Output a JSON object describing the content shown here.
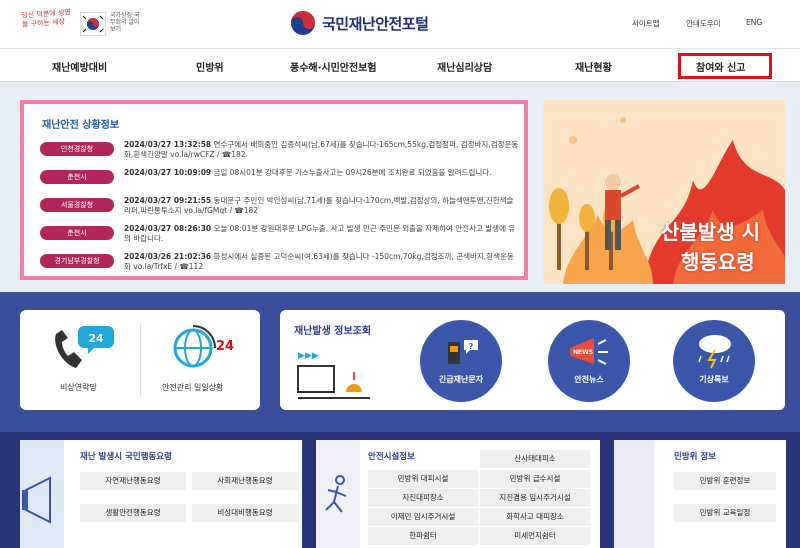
{
  "header": {
    "slogan": "당신 덕분에 생명을 구하는 세상",
    "gov_text": "국가상징 국무회의 알아보기",
    "logo_text": "국민재난안전포털",
    "util": [
      "사이트맵",
      "안내도우미",
      "ENG"
    ]
  },
  "nav": [
    "재난예방대비",
    "민방위",
    "풍수해·시민안전보험",
    "재난심리상담",
    "재난현황",
    "참여와 신고"
  ],
  "status": {
    "title": "재난안전 상황정보",
    "alerts": [
      {
        "badge": "인천경찰청",
        "date": "2024/03/27 13:32:58",
        "text": "연수구에서 배회중인 김종석씨(남,67세)를 찾습니다-165cm,55kg,검정점퍼, 검정바지,검정운동화,흰색긴양말 vo.la/rwCFZ / ☎182"
      },
      {
        "badge": "춘천시",
        "date": "2024/03/27 10:09:09",
        "text": "금일 08시01분 강대후문 가스누출사고는 09시26분에 조치완료 되었음을 알려드립니다."
      },
      {
        "badge": "서울경찰청",
        "date": "2024/03/27 09:21:55",
        "text": "동대문구 주민인 박인성씨(남,71세)를 찾습니다-170cm,백발,검정상의, 하늘색맨투맨,진한색슬리퍼,파란통투소지 vo.la/fGMqt / ☎182"
      },
      {
        "badge": "춘천시",
        "date": "2024/03/27 08:26:30",
        "text": "오늘 08:01분 강원대후문 LPG누출, 사고 발생 인근 주민은 외출을 자제하여 안전사고 발생에 유의 바랍니다."
      },
      {
        "badge": "경기남부경찰청",
        "date": "2024/03/26 21:02:36",
        "text": "화성시에서 실종된 고덕순씨(여,63세)를 찾습니다 -150cm,70kg,검정조끼, 곤색바지,흰색운동화 vo.la/TrfxE / ☎112"
      }
    ]
  },
  "banner": {
    "line1": "산불발생 시",
    "line2": "행동요령"
  },
  "middle": {
    "emergency_contact": "비상연락망",
    "safety_daily": "안전관리 일일상황",
    "info_title": "재난발생 정보조회",
    "buttons": [
      "긴급재난문자",
      "안전뉴스",
      "기상특보"
    ]
  },
  "bottom": {
    "box1_title": "재난 발생시 국민행동요령",
    "box1_items": [
      "자연재난행동요령",
      "사회재난행동요령",
      "생활안전행동요령",
      "비상대비행동요령"
    ],
    "box2_title": "안전시설정보",
    "box2_items": [
      "산사태대피소",
      "민방위 대피시설",
      "민방위 급수시설",
      "지진대피장소",
      "지진겸용 임시주거시설",
      "이재민 임시주거시설",
      "화학사고 대피장소",
      "한파쉼터",
      "미세먼지쉼터"
    ],
    "box3_title": "민방위 정보",
    "box3_items": [
      "민방위 훈련정보",
      "민방위 교육일정"
    ]
  }
}
